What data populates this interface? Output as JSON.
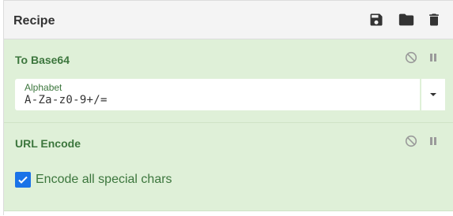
{
  "recipe": {
    "title": "Recipe",
    "actions": [
      {
        "name": "save-icon",
        "label": "Save recipe"
      },
      {
        "name": "folder-icon",
        "label": "Load recipe"
      },
      {
        "name": "trash-icon",
        "label": "Clear recipe"
      }
    ]
  },
  "operations": [
    {
      "title": "To Base64",
      "field": {
        "label": "Alphabet",
        "value": "A-Za-z0-9+/="
      }
    },
    {
      "title": "URL Encode",
      "checkbox": {
        "label": "Encode all special chars",
        "checked": true
      }
    }
  ],
  "colors": {
    "op_background": "#dff0d8",
    "op_text": "#3c763d",
    "checkbox": "#1a73e8",
    "icon": "#333333",
    "op_icon": "#9a9a9a"
  }
}
